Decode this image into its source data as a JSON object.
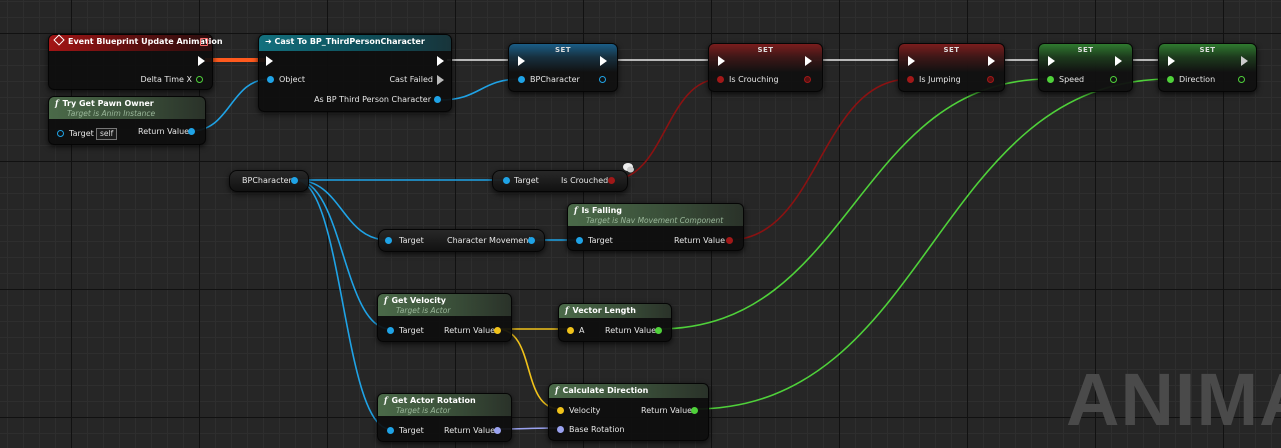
{
  "watermark": "ANIMA",
  "colors": {
    "exec": "#ffffff",
    "object": "#1fa3e6",
    "boolean": "#a11818",
    "float": "#4fd13a",
    "vector": "#f0c21a",
    "rotator": "#9aa2f0",
    "exec_wire_active": "#ff5a1e"
  },
  "nodes": {
    "event": {
      "title": "Event Blueprint Update Animation",
      "delta_label": "Delta Time X"
    },
    "cast": {
      "title": "Cast To BP_ThirdPersonCharacter",
      "object_label": "Object",
      "failed_label": "Cast Failed",
      "as_label": "As BP Third Person Character"
    },
    "pawn_owner": {
      "title": "Try Get Pawn Owner",
      "subtitle": "Target is Anim Instance",
      "target_label": "Target",
      "target_value": "self",
      "return_label": "Return Value"
    },
    "set_bp": {
      "title": "SET",
      "pin_label": "BPCharacter"
    },
    "set_crouch": {
      "title": "SET",
      "pin_label": "Is Crouching"
    },
    "set_jump": {
      "title": "SET",
      "pin_label": "Is Jumping"
    },
    "set_speed": {
      "title": "SET",
      "pin_label": "Speed"
    },
    "set_dir": {
      "title": "SET",
      "pin_label": "Direction"
    },
    "bpchar_get": {
      "label": "BPCharacter"
    },
    "is_crouched": {
      "target_label": "Target",
      "out_label": "Is Crouched"
    },
    "char_movement": {
      "target_label": "Target",
      "out_label": "Character Movement"
    },
    "is_falling": {
      "title": "Is Falling",
      "subtitle": "Target is Nav Movement Component",
      "target_label": "Target",
      "return_label": "Return Value"
    },
    "get_velocity": {
      "title": "Get Velocity",
      "subtitle": "Target is Actor",
      "target_label": "Target",
      "return_label": "Return Value"
    },
    "vector_length": {
      "title": "Vector Length",
      "a_label": "A",
      "return_label": "Return Value"
    },
    "get_rotation": {
      "title": "Get Actor Rotation",
      "subtitle": "Target is Actor",
      "target_label": "Target",
      "return_label": "Return Value"
    },
    "calc_direction": {
      "title": "Calculate Direction",
      "velocity_label": "Velocity",
      "base_label": "Base Rotation",
      "return_label": "Return Value"
    }
  }
}
